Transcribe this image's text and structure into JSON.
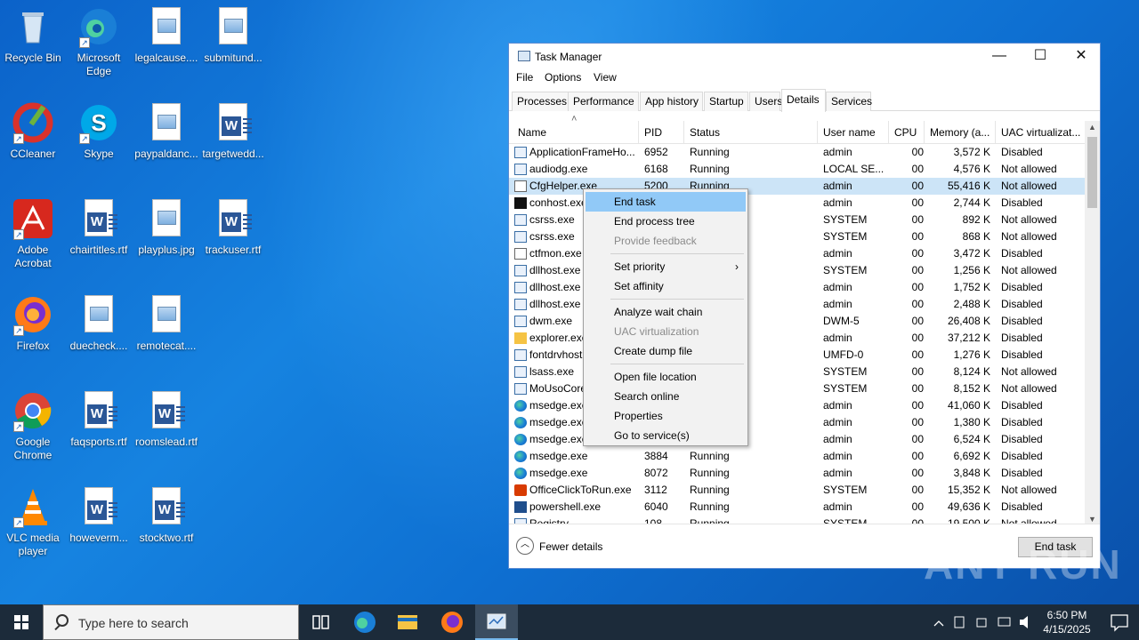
{
  "desktop": {
    "icons": [
      {
        "label": "Recycle Bin",
        "kind": "recycle-bin-icon"
      },
      {
        "label": "Microsoft Edge",
        "kind": "edge-icon"
      },
      {
        "label": "legalcause....",
        "kind": "image-file-icon"
      },
      {
        "label": "submitund...",
        "kind": "image-file-icon"
      },
      {
        "label": "CCleaner",
        "kind": "ccleaner-icon"
      },
      {
        "label": "Skype",
        "kind": "skype-icon"
      },
      {
        "label": "paypaldanc...",
        "kind": "image-file-icon"
      },
      {
        "label": "targetwedd...",
        "kind": "word-file-icon"
      },
      {
        "label": "Adobe Acrobat",
        "kind": "acrobat-icon"
      },
      {
        "label": "chairtitles.rtf",
        "kind": "word-file-icon"
      },
      {
        "label": "playplus.jpg",
        "kind": "image-file-icon"
      },
      {
        "label": "trackuser.rtf",
        "kind": "word-file-icon"
      },
      {
        "label": "Firefox",
        "kind": "firefox-icon"
      },
      {
        "label": "duecheck....",
        "kind": "image-file-icon"
      },
      {
        "label": "remotecat....",
        "kind": "image-file-icon"
      },
      {
        "label": "Google Chrome",
        "kind": "chrome-icon"
      },
      {
        "label": "faqsports.rtf",
        "kind": "word-file-icon"
      },
      {
        "label": "roomslead.rtf",
        "kind": "word-file-icon"
      },
      {
        "label": "VLC media player",
        "kind": "vlc-icon"
      },
      {
        "label": "howeverm...",
        "kind": "word-file-icon"
      },
      {
        "label": "stocktwo.rtf",
        "kind": "word-file-icon"
      }
    ]
  },
  "taskmanager": {
    "title": "Task Manager",
    "controls": {
      "minimize": "—",
      "maximize": "☐",
      "close": "✕"
    },
    "menu": [
      "File",
      "Options",
      "View"
    ],
    "tabs": [
      "Processes",
      "Performance",
      "App history",
      "Startup",
      "Users",
      "Details",
      "Services"
    ],
    "active_tab": "Details",
    "columns": [
      "Name",
      "PID",
      "Status",
      "User name",
      "CPU",
      "Memory (a...",
      "UAC virtualizat..."
    ],
    "rows": [
      {
        "name": "ApplicationFrameHo...",
        "pid": "6952",
        "status": "Running",
        "user": "admin",
        "cpu": "00",
        "mem": "3,572 K",
        "uac": "Disabled",
        "icon": "window"
      },
      {
        "name": "audiodg.exe",
        "pid": "6168",
        "status": "Running",
        "user": "LOCAL SE...",
        "cpu": "00",
        "mem": "4,576 K",
        "uac": "Not allowed",
        "icon": "window"
      },
      {
        "name": "CfgHelper.exe",
        "pid": "5200",
        "status": "Running",
        "user": "admin",
        "cpu": "00",
        "mem": "55,416 K",
        "uac": "Not allowed",
        "icon": "note"
      },
      {
        "name": "conhost.exe",
        "pid": "",
        "status": "",
        "user": "admin",
        "cpu": "00",
        "mem": "2,744 K",
        "uac": "Disabled",
        "icon": "console"
      },
      {
        "name": "csrss.exe",
        "pid": "",
        "status": "",
        "user": "SYSTEM",
        "cpu": "00",
        "mem": "892 K",
        "uac": "Not allowed",
        "icon": "window"
      },
      {
        "name": "csrss.exe",
        "pid": "",
        "status": "",
        "user": "SYSTEM",
        "cpu": "00",
        "mem": "868 K",
        "uac": "Not allowed",
        "icon": "window"
      },
      {
        "name": "ctfmon.exe",
        "pid": "",
        "status": "",
        "user": "admin",
        "cpu": "00",
        "mem": "3,472 K",
        "uac": "Disabled",
        "icon": "note"
      },
      {
        "name": "dllhost.exe",
        "pid": "",
        "status": "",
        "user": "SYSTEM",
        "cpu": "00",
        "mem": "1,256 K",
        "uac": "Not allowed",
        "icon": "window"
      },
      {
        "name": "dllhost.exe",
        "pid": "",
        "status": "",
        "user": "admin",
        "cpu": "00",
        "mem": "1,752 K",
        "uac": "Disabled",
        "icon": "window"
      },
      {
        "name": "dllhost.exe",
        "pid": "",
        "status": "",
        "user": "admin",
        "cpu": "00",
        "mem": "2,488 K",
        "uac": "Disabled",
        "icon": "window"
      },
      {
        "name": "dwm.exe",
        "pid": "",
        "status": "",
        "user": "DWM-5",
        "cpu": "00",
        "mem": "26,408 K",
        "uac": "Disabled",
        "icon": "window"
      },
      {
        "name": "explorer.exe",
        "pid": "",
        "status": "",
        "user": "admin",
        "cpu": "00",
        "mem": "37,212 K",
        "uac": "Disabled",
        "icon": "folder"
      },
      {
        "name": "fontdrvhost",
        "pid": "",
        "status": "",
        "user": "UMFD-0",
        "cpu": "00",
        "mem": "1,276 K",
        "uac": "Disabled",
        "icon": "window"
      },
      {
        "name": "lsass.exe",
        "pid": "",
        "status": "",
        "user": "SYSTEM",
        "cpu": "00",
        "mem": "8,124 K",
        "uac": "Not allowed",
        "icon": "window"
      },
      {
        "name": "MoUsoCore",
        "pid": "",
        "status": "",
        "user": "SYSTEM",
        "cpu": "00",
        "mem": "8,152 K",
        "uac": "Not allowed",
        "icon": "window"
      },
      {
        "name": "msedge.exe",
        "pid": "",
        "status": "",
        "user": "admin",
        "cpu": "00",
        "mem": "41,060 K",
        "uac": "Disabled",
        "icon": "edge"
      },
      {
        "name": "msedge.exe",
        "pid": "",
        "status": "",
        "user": "admin",
        "cpu": "00",
        "mem": "1,380 K",
        "uac": "Disabled",
        "icon": "edge"
      },
      {
        "name": "msedge.exe",
        "pid": "",
        "status": "",
        "user": "admin",
        "cpu": "00",
        "mem": "6,524 K",
        "uac": "Disabled",
        "icon": "edge"
      },
      {
        "name": "msedge.exe",
        "pid": "3884",
        "status": "Running",
        "user": "admin",
        "cpu": "00",
        "mem": "6,692 K",
        "uac": "Disabled",
        "icon": "edge"
      },
      {
        "name": "msedge.exe",
        "pid": "8072",
        "status": "Running",
        "user": "admin",
        "cpu": "00",
        "mem": "3,848 K",
        "uac": "Disabled",
        "icon": "edge"
      },
      {
        "name": "OfficeClickToRun.exe",
        "pid": "3112",
        "status": "Running",
        "user": "SYSTEM",
        "cpu": "00",
        "mem": "15,352 K",
        "uac": "Not allowed",
        "icon": "office"
      },
      {
        "name": "powershell.exe",
        "pid": "6040",
        "status": "Running",
        "user": "admin",
        "cpu": "00",
        "mem": "49,636 K",
        "uac": "Disabled",
        "icon": "ps"
      },
      {
        "name": "Registry",
        "pid": "108",
        "status": "Running",
        "user": "SYSTEM",
        "cpu": "00",
        "mem": "19,500 K",
        "uac": "Not allowed",
        "icon": "window"
      }
    ],
    "footer": {
      "fewer_details": "Fewer details",
      "end_task": "End task"
    }
  },
  "context_menu": {
    "items": [
      {
        "label": "End task",
        "state": "highlighted"
      },
      {
        "label": "End process tree",
        "state": "normal"
      },
      {
        "label": "Provide feedback",
        "state": "disabled"
      },
      {
        "sep": true
      },
      {
        "label": "Set priority",
        "state": "normal",
        "submenu": "›"
      },
      {
        "label": "Set affinity",
        "state": "normal"
      },
      {
        "sep": true
      },
      {
        "label": "Analyze wait chain",
        "state": "normal"
      },
      {
        "label": "UAC virtualization",
        "state": "disabled"
      },
      {
        "label": "Create dump file",
        "state": "normal"
      },
      {
        "sep": true
      },
      {
        "label": "Open file location",
        "state": "normal"
      },
      {
        "label": "Search online",
        "state": "normal"
      },
      {
        "label": "Properties",
        "state": "normal"
      },
      {
        "label": "Go to service(s)",
        "state": "normal"
      }
    ]
  },
  "taskbar": {
    "search_placeholder": "Type here to search",
    "time": "6:50 PM",
    "date": "4/15/2025"
  },
  "watermark": "ANY RUN"
}
